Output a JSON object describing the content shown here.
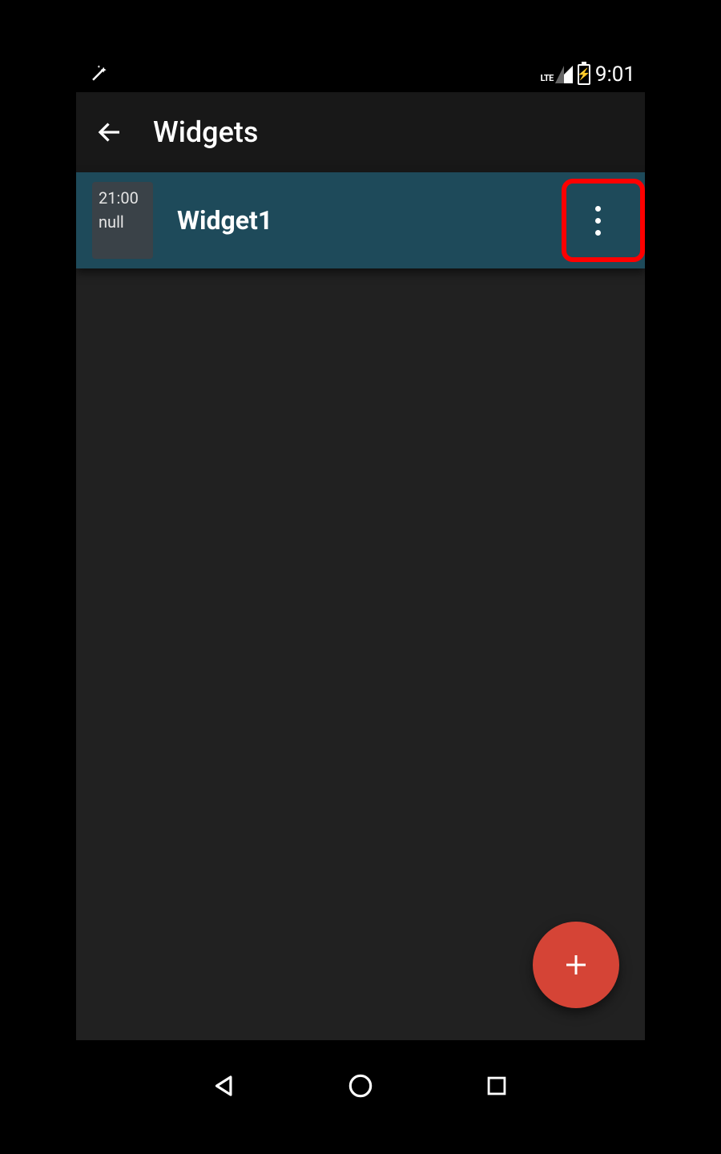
{
  "status_bar": {
    "network_label": "LTE",
    "clock": "9:01"
  },
  "app_bar": {
    "title": "Widgets"
  },
  "list": {
    "items": [
      {
        "thumb_line1": "21:00",
        "thumb_line2": "null",
        "title": "Widget1"
      }
    ]
  },
  "highlight": {
    "target": "more-options-button",
    "color": "#ff0000"
  }
}
